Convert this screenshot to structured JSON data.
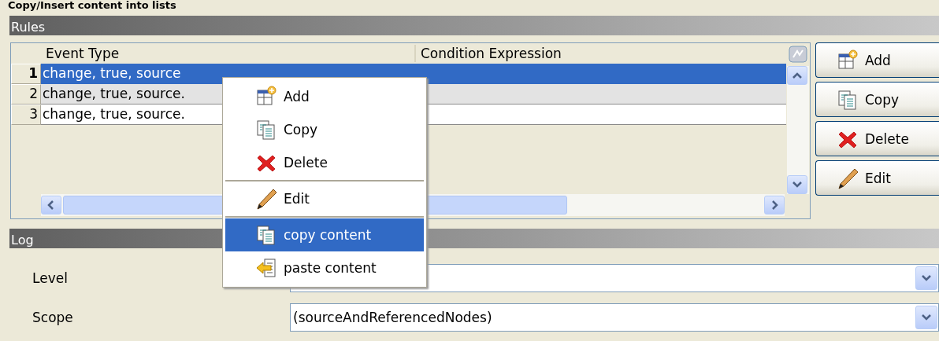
{
  "page_title": "Copy/Insert content into lists",
  "rules": {
    "title": "Rules",
    "table": {
      "columns": [
        "Event Type",
        "Condition Expression"
      ],
      "rows": [
        {
          "number": "1",
          "event_type": "change, true, source",
          "selected": true
        },
        {
          "number": "2",
          "event_type": "change, true, source.",
          "selected": false
        },
        {
          "number": "3",
          "event_type": "change, true, source.",
          "selected": false
        }
      ]
    },
    "buttons": [
      {
        "label": "Add"
      },
      {
        "label": "Copy"
      },
      {
        "label": "Delete"
      },
      {
        "label": "Edit"
      }
    ]
  },
  "context_menu": {
    "items": [
      {
        "kind": "item",
        "label": "Add",
        "selected": false
      },
      {
        "kind": "item",
        "label": "Copy",
        "selected": false
      },
      {
        "kind": "item",
        "label": "Delete",
        "selected": false
      },
      {
        "kind": "separator"
      },
      {
        "kind": "item",
        "label": "Edit",
        "selected": false
      },
      {
        "kind": "separator"
      },
      {
        "kind": "item",
        "label": "copy content",
        "selected": true
      },
      {
        "kind": "item",
        "label": "paste content",
        "selected": false
      }
    ]
  },
  "log": {
    "title": "Log",
    "fields": [
      {
        "label": "Level"
      },
      {
        "label": "Scope",
        "value": "(sourceAndReferencedNodes)"
      }
    ]
  }
}
